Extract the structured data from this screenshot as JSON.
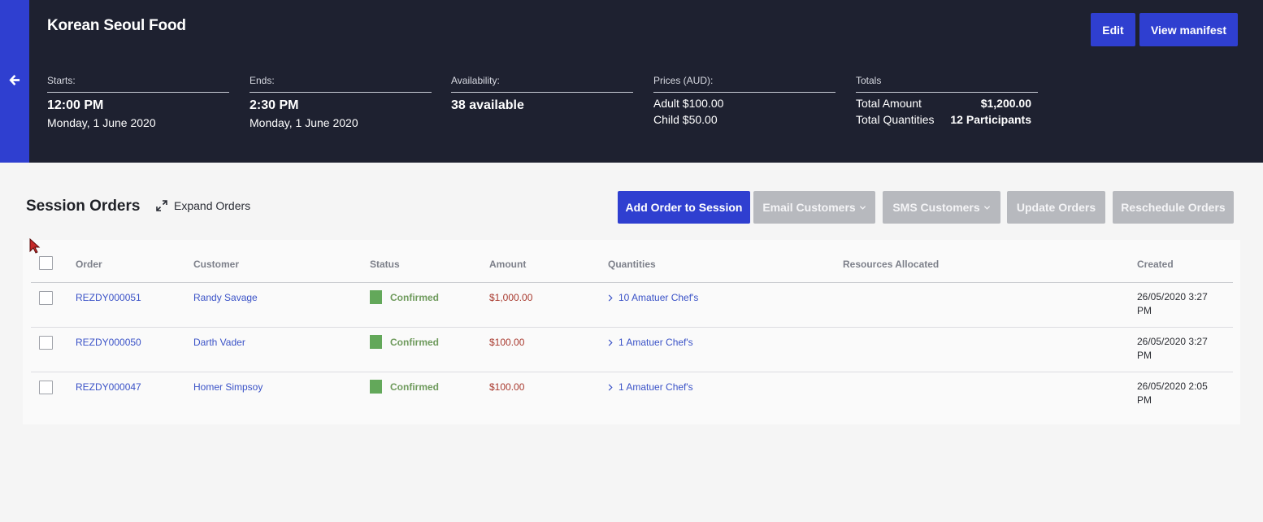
{
  "session": {
    "title": "Korean Seoul Food",
    "edit_label": "Edit",
    "manifest_label": "View manifest",
    "starts_label": "Starts:",
    "starts_time": "12:00 PM",
    "starts_date": "Monday, 1 June 2020",
    "ends_label": "Ends:",
    "ends_time": "2:30 PM",
    "ends_date": "Monday, 1 June 2020",
    "availability_label": "Availability:",
    "availability_value": "38 available",
    "prices_label": "Prices (AUD):",
    "price_adult": "Adult $100.00",
    "price_child": "Child $50.00",
    "totals_label": "Totals",
    "total_amount_label": "Total Amount",
    "total_amount_value": "$1,200.00",
    "total_qty_label": "Total Quantities",
    "total_qty_value": "12 Participants"
  },
  "orders_section": {
    "title": "Session Orders",
    "expand_label": "Expand Orders",
    "add_order": "Add Order to Session",
    "email_customers": "Email Customers",
    "sms_customers": "SMS Customers",
    "update_orders": "Update Orders",
    "reschedule_orders": "Reschedule Orders"
  },
  "table": {
    "columns": [
      "Order",
      "Customer",
      "Status",
      "Amount",
      "Quantities",
      "Resources Allocated",
      "Created"
    ],
    "rows": [
      {
        "order": "REZDY000051",
        "customer": "Randy Savage",
        "status": "Confirmed",
        "amount": "$1,000.00",
        "quantities": "10 Amatuer Chef's",
        "resources": "",
        "created": "26/05/2020 3:27 PM"
      },
      {
        "order": "REZDY000050",
        "customer": "Darth Vader",
        "status": "Confirmed",
        "amount": "$100.00",
        "quantities": "1 Amatuer Chef's",
        "resources": "",
        "created": "26/05/2020 3:27 PM"
      },
      {
        "order": "REZDY000047",
        "customer": "Homer Simpsoy",
        "status": "Confirmed",
        "amount": "$100.00",
        "quantities": "1 Amatuer Chef's",
        "resources": "",
        "created": "26/05/2020 2:05 PM"
      }
    ]
  },
  "colors": {
    "header_bg": "#1e2130",
    "accent": "#2f3fd0",
    "confirmed": "#63a85a",
    "amount": "#a8392e",
    "link": "#3a52c7"
  }
}
